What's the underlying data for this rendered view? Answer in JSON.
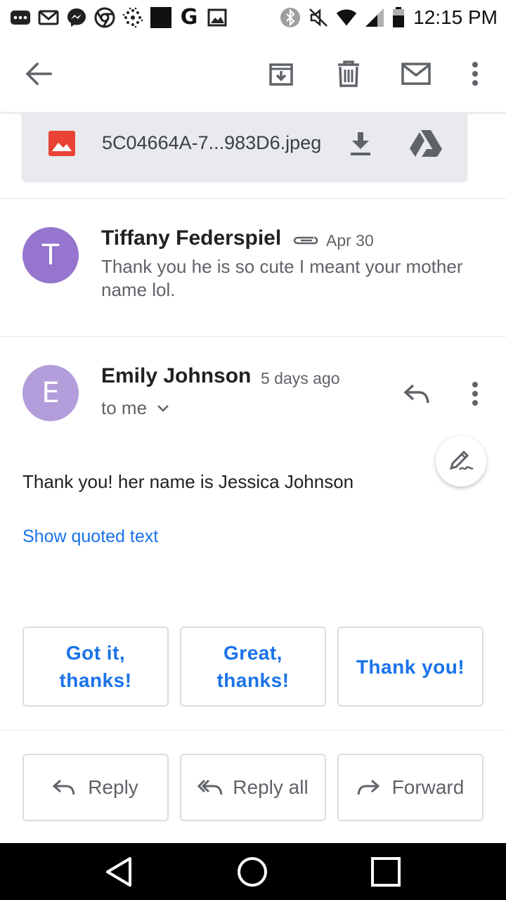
{
  "status_bar": {
    "time": "12:15 PM",
    "left_icons": [
      "more-notifications-icon",
      "gmail-icon",
      "messenger-icon",
      "chrome-icon",
      "dots-app-icon",
      "black-square-app-icon",
      "google-icon",
      "photo-icon"
    ],
    "google_letter": "G",
    "right_icons": [
      "bluetooth-icon",
      "mute-icon",
      "wifi-icon",
      "signal-icon",
      "battery-icon"
    ]
  },
  "toolbar": {
    "icons": [
      "back-arrow-icon",
      "archive-icon",
      "delete-icon",
      "mark-unread-icon",
      "more-vert-icon"
    ]
  },
  "attachment": {
    "filename": "5C04664A-7...983D6.jpeg",
    "icon": "image-file-icon",
    "actions": [
      "download-icon",
      "save-to-drive-icon"
    ]
  },
  "messages": [
    {
      "avatar_letter": "T",
      "avatar_color": "#9575cd",
      "sender": "Tiffany Federspiel",
      "date": "Apr 30",
      "has_attachment": true,
      "snippet": "Thank you he is so cute I meant your mother name lol."
    },
    {
      "avatar_letter": "E",
      "avatar_color": "#b39ddb",
      "sender": "Emily Johnson",
      "date": "5 days ago",
      "recipient": "to me",
      "body": "Thank you! her name is Jessica Johnson",
      "show_quoted": "Show quoted text"
    }
  ],
  "smart_replies": [
    "Got it, thanks!",
    "Great, thanks!",
    "Thank you!"
  ],
  "actions": {
    "reply": "Reply",
    "reply_all": "Reply all",
    "forward": "Forward"
  },
  "colors": {
    "accent_blue": "#1a73e8",
    "attachment_bg": "#e8eaed",
    "image_icon_red": "#ea4335"
  }
}
